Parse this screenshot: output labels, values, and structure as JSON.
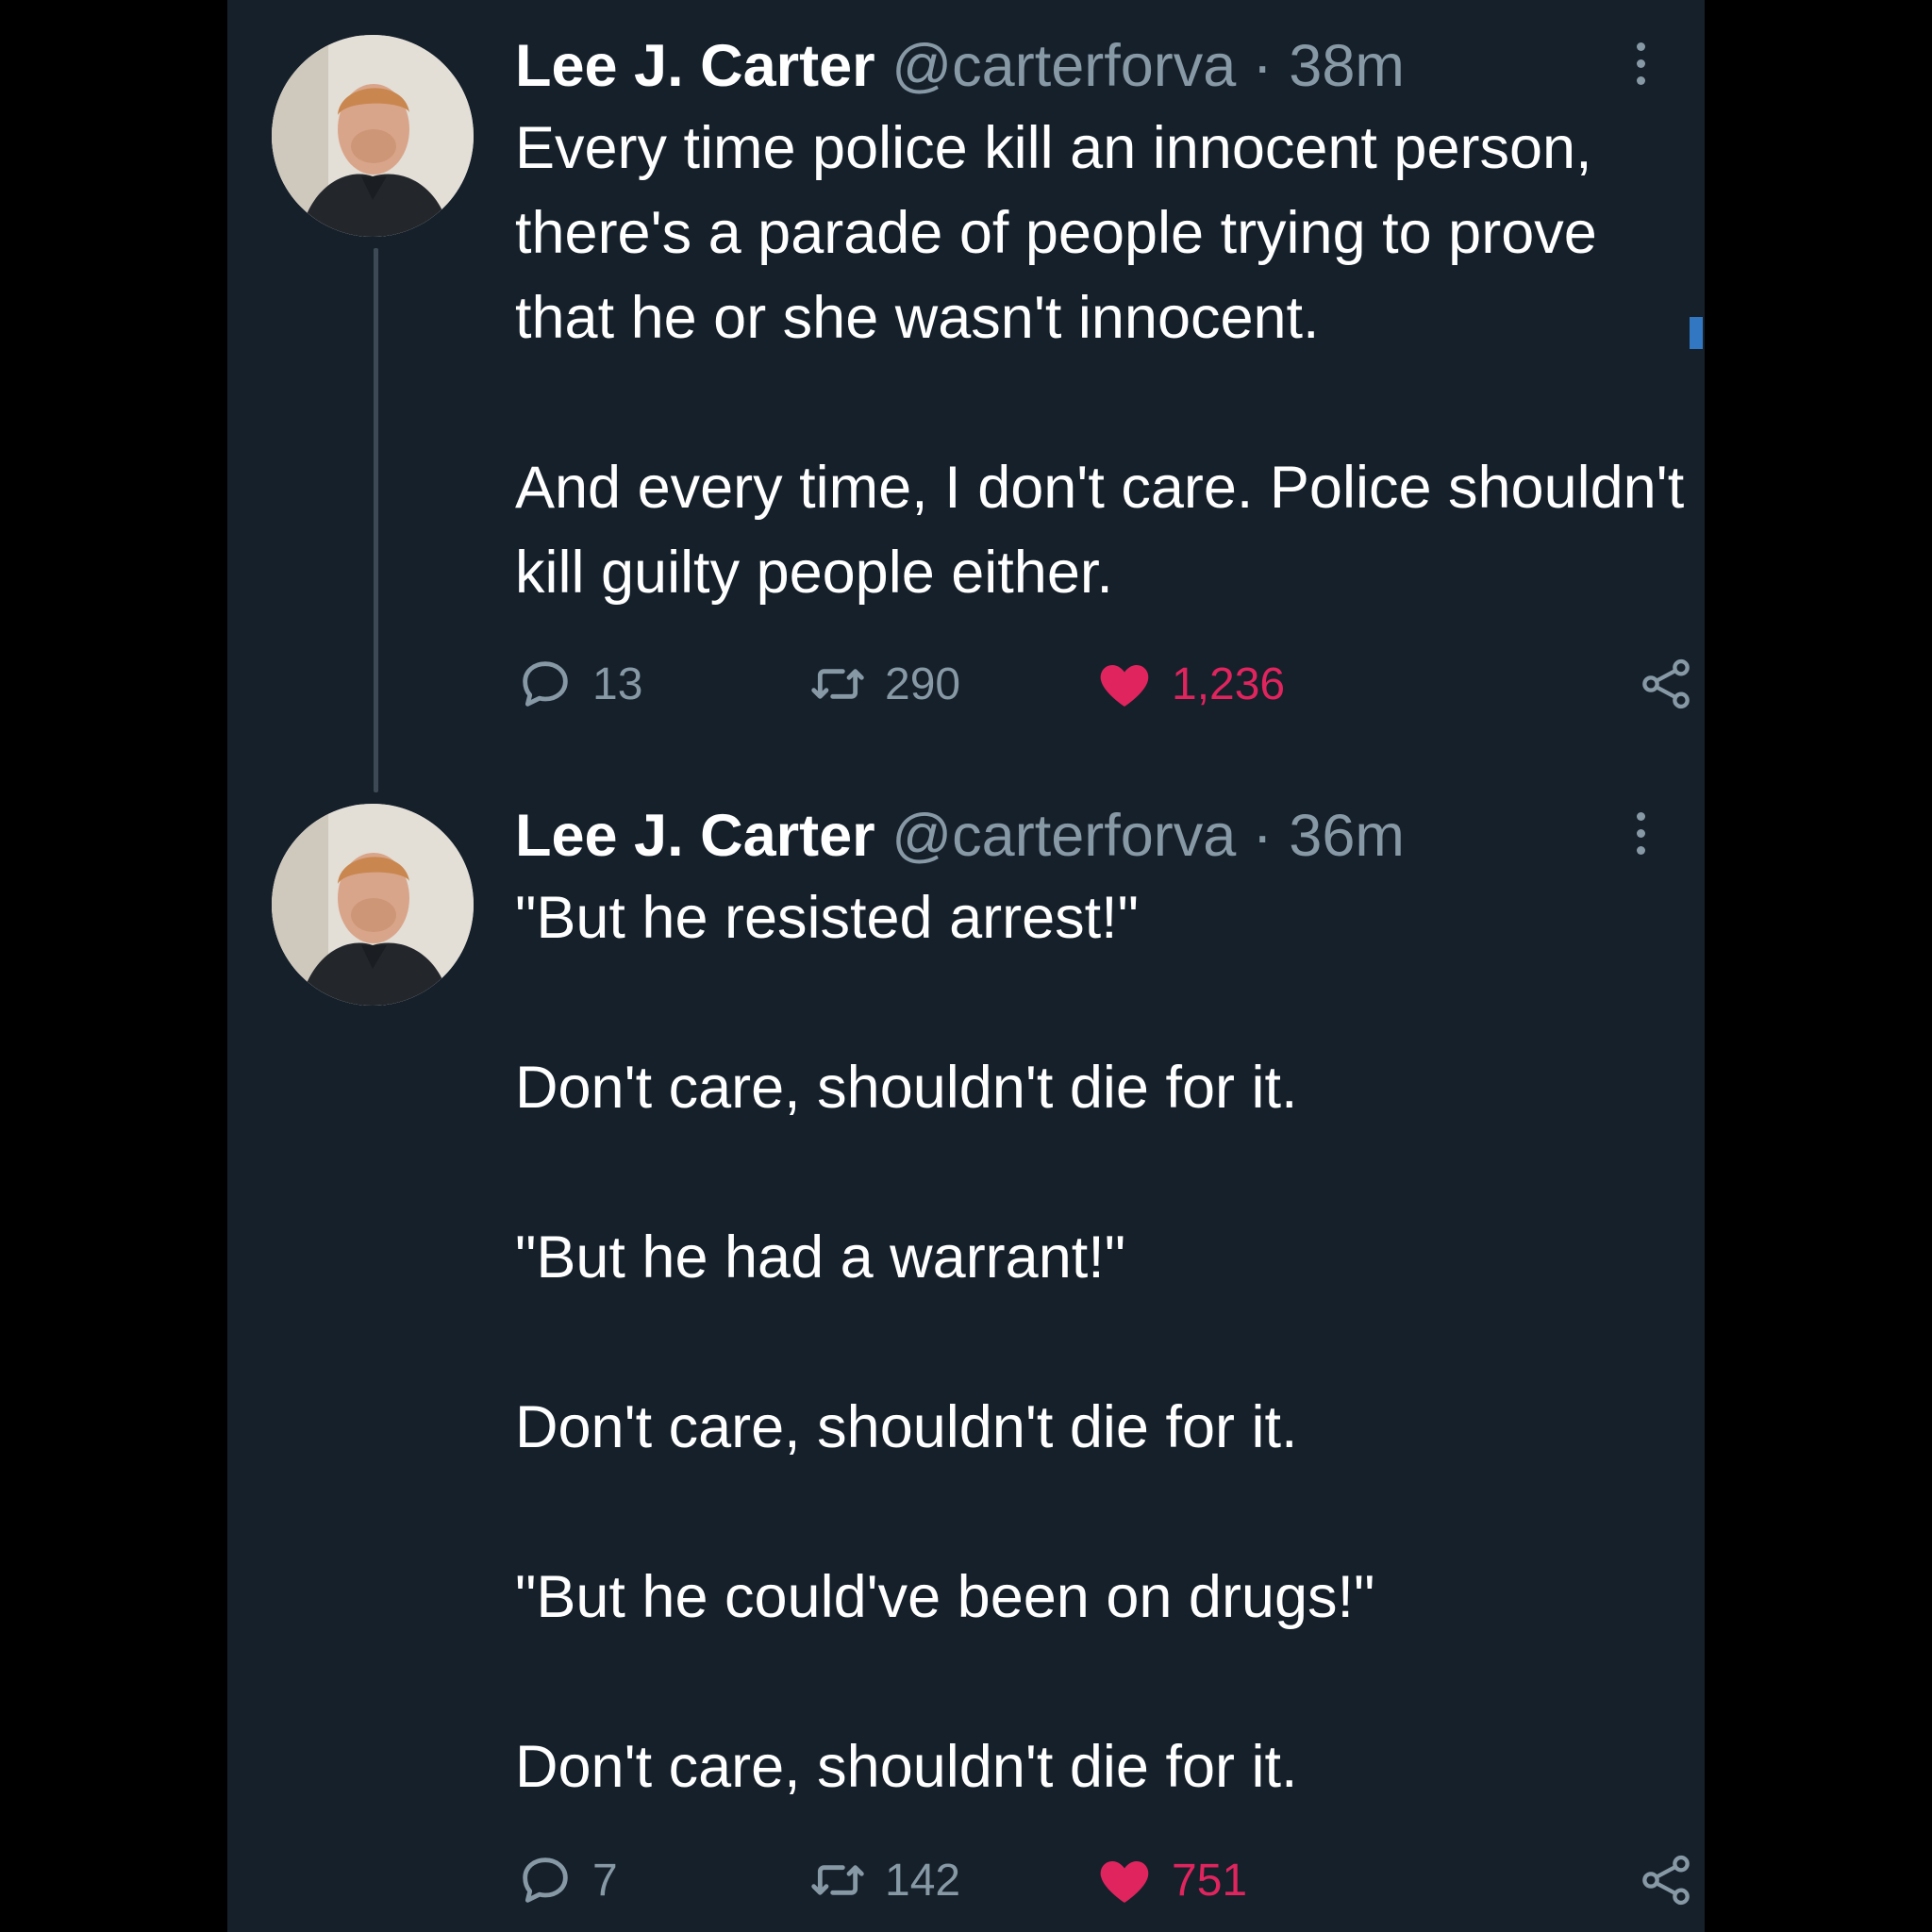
{
  "tweets": [
    {
      "author": "Lee J. Carter",
      "handle": "@carterforva",
      "separator": "·",
      "time": "38m",
      "paragraphs": [
        "Every time police kill an innocent person, there's a parade of people trying to prove that he or she wasn't innocent.",
        "And every time, I don't care.  Police shouldn't kill guilty people either."
      ],
      "replies": "13",
      "retweets": "290",
      "likes": "1,236"
    },
    {
      "author": "Lee J. Carter",
      "handle": "@carterforva",
      "separator": "·",
      "time": "36m",
      "paragraphs": [
        "\"But he resisted arrest!\"",
        "Don't care, shouldn't die for it.",
        "\"But he had a warrant!\"",
        "Don't care, shouldn't die for it.",
        "\"But he could've been on drugs!\"",
        "Don't care, shouldn't die for it."
      ],
      "replies": "7",
      "retweets": "142",
      "likes": "751"
    }
  ],
  "icons": {
    "reply": "reply-icon",
    "retweet": "retweet-icon",
    "like": "heart-icon",
    "share": "share-icon",
    "more": "more-vertical-icon"
  },
  "colors": {
    "background": "#15202b",
    "text": "#ffffff",
    "secondary": "#8899a6",
    "like": "#e0245e"
  }
}
